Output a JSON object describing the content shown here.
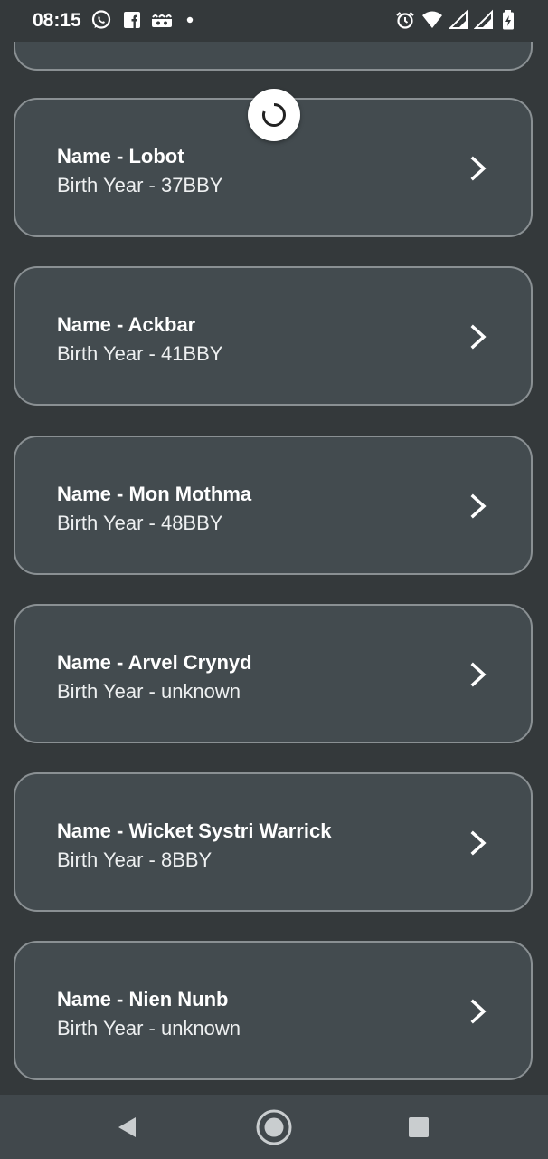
{
  "status_bar": {
    "time": "08:15",
    "icons": [
      "whatsapp-icon",
      "facebook-icon",
      "voicemail-icon",
      "dot-icon",
      "alarm-icon",
      "wifi-icon",
      "signal-icon",
      "signal-icon-2",
      "battery-icon"
    ]
  },
  "loading_indicator": "spinner-icon",
  "characters": [
    {
      "name": "Name - Lobot",
      "birth_year": "Birth Year - 37BBY"
    },
    {
      "name": "Name - Ackbar",
      "birth_year": "Birth Year - 41BBY"
    },
    {
      "name": "Name - Mon Mothma",
      "birth_year": "Birth Year - 48BBY"
    },
    {
      "name": "Name - Arvel Crynyd",
      "birth_year": "Birth Year - unknown"
    },
    {
      "name": "Name - Wicket Systri Warrick",
      "birth_year": "Birth Year - 8BBY"
    },
    {
      "name": "Name - Nien Nunb",
      "birth_year": "Birth Year - unknown"
    }
  ],
  "nav_bar": {
    "buttons": [
      "back-icon",
      "home-icon",
      "recents-icon"
    ]
  },
  "colors": {
    "background": "#34393b",
    "card": "#434b4f",
    "card_border": "#8a9093",
    "nav_bar": "#41484c"
  }
}
